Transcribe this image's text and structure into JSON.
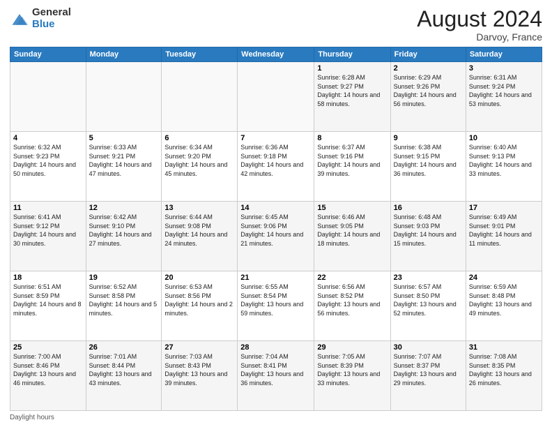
{
  "logo": {
    "general": "General",
    "blue": "Blue"
  },
  "header": {
    "month_year": "August 2024",
    "location": "Darvoy, France"
  },
  "days_of_week": [
    "Sunday",
    "Monday",
    "Tuesday",
    "Wednesday",
    "Thursday",
    "Friday",
    "Saturday"
  ],
  "weeks": [
    [
      {
        "day": "",
        "sunrise": "",
        "sunset": "",
        "daylight": ""
      },
      {
        "day": "",
        "sunrise": "",
        "sunset": "",
        "daylight": ""
      },
      {
        "day": "",
        "sunrise": "",
        "sunset": "",
        "daylight": ""
      },
      {
        "day": "",
        "sunrise": "",
        "sunset": "",
        "daylight": ""
      },
      {
        "day": "1",
        "sunrise": "Sunrise: 6:28 AM",
        "sunset": "Sunset: 9:27 PM",
        "daylight": "Daylight: 14 hours and 58 minutes."
      },
      {
        "day": "2",
        "sunrise": "Sunrise: 6:29 AM",
        "sunset": "Sunset: 9:26 PM",
        "daylight": "Daylight: 14 hours and 56 minutes."
      },
      {
        "day": "3",
        "sunrise": "Sunrise: 6:31 AM",
        "sunset": "Sunset: 9:24 PM",
        "daylight": "Daylight: 14 hours and 53 minutes."
      }
    ],
    [
      {
        "day": "4",
        "sunrise": "Sunrise: 6:32 AM",
        "sunset": "Sunset: 9:23 PM",
        "daylight": "Daylight: 14 hours and 50 minutes."
      },
      {
        "day": "5",
        "sunrise": "Sunrise: 6:33 AM",
        "sunset": "Sunset: 9:21 PM",
        "daylight": "Daylight: 14 hours and 47 minutes."
      },
      {
        "day": "6",
        "sunrise": "Sunrise: 6:34 AM",
        "sunset": "Sunset: 9:20 PM",
        "daylight": "Daylight: 14 hours and 45 minutes."
      },
      {
        "day": "7",
        "sunrise": "Sunrise: 6:36 AM",
        "sunset": "Sunset: 9:18 PM",
        "daylight": "Daylight: 14 hours and 42 minutes."
      },
      {
        "day": "8",
        "sunrise": "Sunrise: 6:37 AM",
        "sunset": "Sunset: 9:16 PM",
        "daylight": "Daylight: 14 hours and 39 minutes."
      },
      {
        "day": "9",
        "sunrise": "Sunrise: 6:38 AM",
        "sunset": "Sunset: 9:15 PM",
        "daylight": "Daylight: 14 hours and 36 minutes."
      },
      {
        "day": "10",
        "sunrise": "Sunrise: 6:40 AM",
        "sunset": "Sunset: 9:13 PM",
        "daylight": "Daylight: 14 hours and 33 minutes."
      }
    ],
    [
      {
        "day": "11",
        "sunrise": "Sunrise: 6:41 AM",
        "sunset": "Sunset: 9:12 PM",
        "daylight": "Daylight: 14 hours and 30 minutes."
      },
      {
        "day": "12",
        "sunrise": "Sunrise: 6:42 AM",
        "sunset": "Sunset: 9:10 PM",
        "daylight": "Daylight: 14 hours and 27 minutes."
      },
      {
        "day": "13",
        "sunrise": "Sunrise: 6:44 AM",
        "sunset": "Sunset: 9:08 PM",
        "daylight": "Daylight: 14 hours and 24 minutes."
      },
      {
        "day": "14",
        "sunrise": "Sunrise: 6:45 AM",
        "sunset": "Sunset: 9:06 PM",
        "daylight": "Daylight: 14 hours and 21 minutes."
      },
      {
        "day": "15",
        "sunrise": "Sunrise: 6:46 AM",
        "sunset": "Sunset: 9:05 PM",
        "daylight": "Daylight: 14 hours and 18 minutes."
      },
      {
        "day": "16",
        "sunrise": "Sunrise: 6:48 AM",
        "sunset": "Sunset: 9:03 PM",
        "daylight": "Daylight: 14 hours and 15 minutes."
      },
      {
        "day": "17",
        "sunrise": "Sunrise: 6:49 AM",
        "sunset": "Sunset: 9:01 PM",
        "daylight": "Daylight: 14 hours and 11 minutes."
      }
    ],
    [
      {
        "day": "18",
        "sunrise": "Sunrise: 6:51 AM",
        "sunset": "Sunset: 8:59 PM",
        "daylight": "Daylight: 14 hours and 8 minutes."
      },
      {
        "day": "19",
        "sunrise": "Sunrise: 6:52 AM",
        "sunset": "Sunset: 8:58 PM",
        "daylight": "Daylight: 14 hours and 5 minutes."
      },
      {
        "day": "20",
        "sunrise": "Sunrise: 6:53 AM",
        "sunset": "Sunset: 8:56 PM",
        "daylight": "Daylight: 14 hours and 2 minutes."
      },
      {
        "day": "21",
        "sunrise": "Sunrise: 6:55 AM",
        "sunset": "Sunset: 8:54 PM",
        "daylight": "Daylight: 13 hours and 59 minutes."
      },
      {
        "day": "22",
        "sunrise": "Sunrise: 6:56 AM",
        "sunset": "Sunset: 8:52 PM",
        "daylight": "Daylight: 13 hours and 56 minutes."
      },
      {
        "day": "23",
        "sunrise": "Sunrise: 6:57 AM",
        "sunset": "Sunset: 8:50 PM",
        "daylight": "Daylight: 13 hours and 52 minutes."
      },
      {
        "day": "24",
        "sunrise": "Sunrise: 6:59 AM",
        "sunset": "Sunset: 8:48 PM",
        "daylight": "Daylight: 13 hours and 49 minutes."
      }
    ],
    [
      {
        "day": "25",
        "sunrise": "Sunrise: 7:00 AM",
        "sunset": "Sunset: 8:46 PM",
        "daylight": "Daylight: 13 hours and 46 minutes."
      },
      {
        "day": "26",
        "sunrise": "Sunrise: 7:01 AM",
        "sunset": "Sunset: 8:44 PM",
        "daylight": "Daylight: 13 hours and 43 minutes."
      },
      {
        "day": "27",
        "sunrise": "Sunrise: 7:03 AM",
        "sunset": "Sunset: 8:43 PM",
        "daylight": "Daylight: 13 hours and 39 minutes."
      },
      {
        "day": "28",
        "sunrise": "Sunrise: 7:04 AM",
        "sunset": "Sunset: 8:41 PM",
        "daylight": "Daylight: 13 hours and 36 minutes."
      },
      {
        "day": "29",
        "sunrise": "Sunrise: 7:05 AM",
        "sunset": "Sunset: 8:39 PM",
        "daylight": "Daylight: 13 hours and 33 minutes."
      },
      {
        "day": "30",
        "sunrise": "Sunrise: 7:07 AM",
        "sunset": "Sunset: 8:37 PM",
        "daylight": "Daylight: 13 hours and 29 minutes."
      },
      {
        "day": "31",
        "sunrise": "Sunrise: 7:08 AM",
        "sunset": "Sunset: 8:35 PM",
        "daylight": "Daylight: 13 hours and 26 minutes."
      }
    ]
  ],
  "footer": {
    "note": "Daylight hours"
  }
}
